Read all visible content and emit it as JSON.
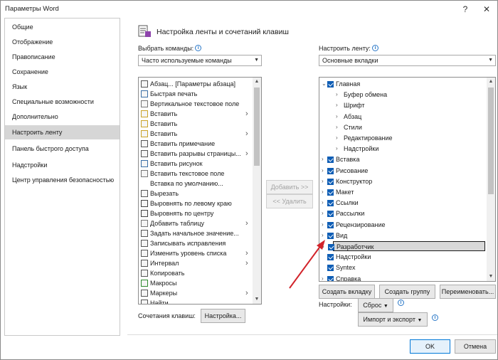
{
  "window": {
    "title": "Параметры Word",
    "help": "?",
    "close": "✕"
  },
  "sidebar": {
    "items": [
      {
        "label": "Общие"
      },
      {
        "label": "Отображение"
      },
      {
        "label": "Правописание"
      },
      {
        "label": "Сохранение"
      },
      {
        "label": "Язык"
      },
      {
        "label": "Специальные возможности"
      },
      {
        "label": "Дополнительно"
      },
      {
        "label": "Настроить ленту"
      },
      {
        "label": "Панель быстрого доступа"
      },
      {
        "label": "Надстройки"
      },
      {
        "label": "Центр управления безопасностью"
      }
    ],
    "active": "Настроить ленту"
  },
  "header": {
    "title": "Настройка ленты и сочетаний клавиш"
  },
  "left": {
    "choose_label": "Выбрать команды:",
    "choose_value": "Часто используемые команды",
    "commands": [
      {
        "label": "Абзац... [Параметры абзаца]",
        "icon": "paragraph-icon",
        "arrow": false
      },
      {
        "label": "Быстрая печать",
        "icon": "print-icon",
        "arrow": false
      },
      {
        "label": "Вертикальное текстовое поле",
        "icon": "textbox-icon",
        "arrow": false
      },
      {
        "label": "Вставить",
        "icon": "paste-icon",
        "arrow": true
      },
      {
        "label": "Вставить",
        "icon": "paste-icon",
        "arrow": false
      },
      {
        "label": "Вставить",
        "icon": "paste-icon",
        "arrow": true
      },
      {
        "label": "Вставить примечание",
        "icon": "comment-icon",
        "arrow": false
      },
      {
        "label": "Вставить разрывы страницы...",
        "icon": "page-break-icon",
        "arrow": true
      },
      {
        "label": "Вставить рисунок",
        "icon": "picture-icon",
        "arrow": false
      },
      {
        "label": "Вставить текстовое поле",
        "icon": "textbox-icon",
        "arrow": false
      },
      {
        "label": "Вставка по умолчанию...",
        "icon": "",
        "arrow": false
      },
      {
        "label": "Вырезать",
        "icon": "cut-icon",
        "arrow": false
      },
      {
        "label": "Выровнять по левому краю",
        "icon": "align-left-icon",
        "arrow": false
      },
      {
        "label": "Выровнять по центру",
        "icon": "align-center-icon",
        "arrow": false
      },
      {
        "label": "Добавить таблицу",
        "icon": "table-icon",
        "arrow": true
      },
      {
        "label": "Задать начальное значение...",
        "icon": "numbering-icon",
        "arrow": false
      },
      {
        "label": "Записывать исправления",
        "icon": "track-changes-icon",
        "arrow": false
      },
      {
        "label": "Изменить уровень списка",
        "icon": "list-level-icon",
        "arrow": true
      },
      {
        "label": "Интервал",
        "icon": "spacing-icon",
        "arrow": true
      },
      {
        "label": "Копировать",
        "icon": "copy-icon",
        "arrow": false
      },
      {
        "label": "Макросы",
        "icon": "macros-icon",
        "arrow": false
      },
      {
        "label": "Маркеры",
        "icon": "bullets-icon",
        "arrow": true
      },
      {
        "label": "Найти",
        "icon": "find-icon",
        "arrow": false
      }
    ],
    "shortcuts_label": "Сочетания клавиш:",
    "shortcuts_button": "Настройка..."
  },
  "middle": {
    "add": "Добавить >>",
    "remove": "<< Удалить"
  },
  "right": {
    "customize_label": "Настроить ленту:",
    "customize_value": "Основные вкладки",
    "tabs": [
      {
        "label": "Главная",
        "level": 0,
        "check": true,
        "exp": "v"
      },
      {
        "label": "Буфер обмена",
        "level": 1,
        "check": false,
        "exp": ">"
      },
      {
        "label": "Шрифт",
        "level": 1,
        "check": false,
        "exp": ">"
      },
      {
        "label": "Абзац",
        "level": 1,
        "check": false,
        "exp": ">"
      },
      {
        "label": "Стили",
        "level": 1,
        "check": false,
        "exp": ">"
      },
      {
        "label": "Редактирование",
        "level": 1,
        "check": false,
        "exp": ">"
      },
      {
        "label": "Надстройки",
        "level": 1,
        "check": false,
        "exp": ">"
      },
      {
        "label": "Вставка",
        "level": 0,
        "check": true,
        "exp": ">"
      },
      {
        "label": "Рисование",
        "level": 0,
        "check": true,
        "exp": ">"
      },
      {
        "label": "Конструктор",
        "level": 0,
        "check": true,
        "exp": ">"
      },
      {
        "label": "Макет",
        "level": 0,
        "check": true,
        "exp": ">"
      },
      {
        "label": "Ссылки",
        "level": 0,
        "check": true,
        "exp": ">"
      },
      {
        "label": "Рассылки",
        "level": 0,
        "check": true,
        "exp": ">"
      },
      {
        "label": "Рецензирование",
        "level": 0,
        "check": true,
        "exp": ">"
      },
      {
        "label": "Вид",
        "level": 0,
        "check": true,
        "exp": ">"
      },
      {
        "label": "Разработчик",
        "level": 0,
        "check": true,
        "exp": ">"
      },
      {
        "label": "Надстройки",
        "level": 0,
        "check": true,
        "exp": ""
      },
      {
        "label": "Syntex",
        "level": 0,
        "check": true,
        "exp": ""
      },
      {
        "label": "Справка",
        "level": 0,
        "check": true,
        "exp": ">"
      }
    ],
    "selected": "Разработчик",
    "new_tab": "Создать вкладку",
    "new_group": "Создать группу",
    "rename": "Переименовать...",
    "settings_label": "Настройки:",
    "reset": "Сброс",
    "import_export": "Импорт и экспорт"
  },
  "footer": {
    "ok": "OK",
    "cancel": "Отмена"
  },
  "colors": {
    "accent": "#0078d7",
    "check": "#0f5eb5",
    "annotation_arrow": "#d2232a"
  }
}
